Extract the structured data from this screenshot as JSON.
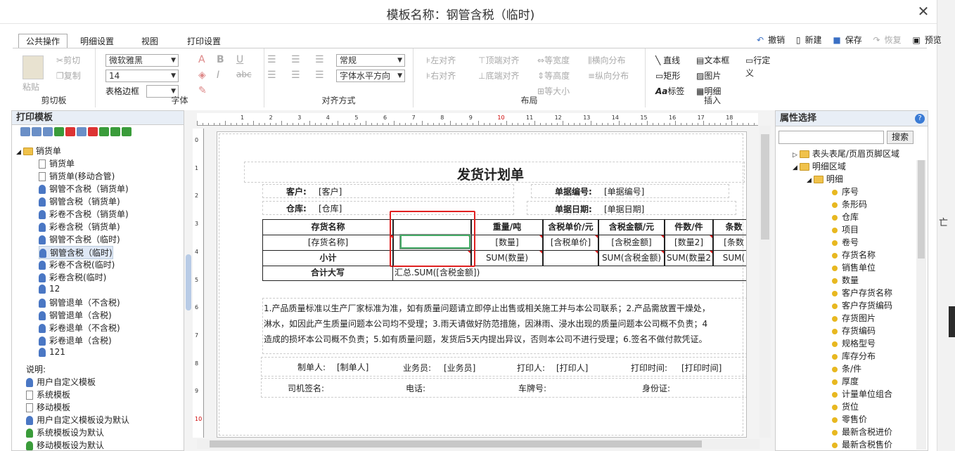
{
  "window": {
    "title": "模板名称：钢管含税（临时)",
    "close": "✕"
  },
  "ribbon": {
    "tabs": [
      "公共操作",
      "明细设置",
      "视图",
      "打印设置"
    ],
    "quick": {
      "undo": "撤销",
      "new": "新建",
      "save": "保存",
      "restore": "恢复",
      "preview": "预览"
    },
    "clipboard": {
      "paste": "粘贴",
      "cut": "剪切",
      "copy": "复制",
      "label": "剪切板"
    },
    "font": {
      "family": "微软雅黑",
      "size": "14",
      "border_label": "表格边框",
      "label": "字体"
    },
    "align": {
      "style": "常规",
      "direction": "字体水平方向",
      "label": "对齐方式"
    },
    "layout": {
      "left": "左对齐",
      "right": "右对齐",
      "top": "顶端对齐",
      "bottom": "底端对齐",
      "eqw": "等宽度",
      "eqh": "等高度",
      "eqsize": "等大小",
      "hdist": "横向分布",
      "vdist": "纵向分布",
      "label": "布局"
    },
    "insert": {
      "line": "直线",
      "rect": "矩形",
      "tag": "标签",
      "textbox": "文本框",
      "image": "图片",
      "detail": "明细",
      "rowdef": "行定义",
      "label": "插入"
    }
  },
  "left": {
    "title": "打印模板",
    "root": "销货单",
    "items": [
      "销货单",
      "销货单(移动合管)",
      "钢管不含税（销货单)",
      "钢管含税（销货单)",
      "彩卷不含税（销货单)",
      "彩卷含税（销货单)",
      "钢管不含税（临时)",
      "钢管含税（临时)",
      "彩卷不含税(临时)",
      "彩卷含税(临时)",
      "12",
      "钢管退单（不含税)",
      "钢管退单（含税)",
      "彩卷退单（不含税)",
      "彩卷退单（含税)",
      "121"
    ],
    "notes_title": "说明:",
    "notes": [
      "用户自定义模板",
      "系统模板",
      "移动模板",
      "用户自定义模板设为默认",
      "系统模板设为默认",
      "移动模板设为默认"
    ]
  },
  "ruler": {
    "h": [
      "1",
      "2",
      "3",
      "4",
      "5",
      "6",
      "7",
      "8",
      "9",
      "10",
      "11",
      "12",
      "13",
      "14",
      "15",
      "16",
      "17",
      "18"
    ],
    "v": [
      "0",
      "1",
      "2",
      "3",
      "4",
      "5",
      "6",
      "7",
      "8",
      "9",
      "10"
    ]
  },
  "doc": {
    "title": "发货计划单",
    "customer_label": "客户:",
    "customer_val": "[客户]",
    "billno_label": "单据编号:",
    "billno_val": "[单据编号]",
    "warehouse_label": "仓库:",
    "warehouse_val": "[仓库]",
    "billdate_label": "单据日期:",
    "billdate_val": "[单据日期]",
    "headers": [
      "存货名称",
      "",
      "重量/吨",
      "含税单价/元",
      "含税金额/元",
      "件数/件",
      "条数"
    ],
    "row1": [
      "[存货名称]",
      "",
      "[数量]",
      "[含税单价]",
      "[含税金额]",
      "[数量2]",
      "[条数"
    ],
    "row2": [
      "小计",
      "",
      "SUM(数量)",
      "",
      "SUM(含税金额)",
      "SUM(数量2",
      "SUM("
    ],
    "total_label": "合计大写",
    "total_val": "汇总.SUM([含税金额])",
    "notes": [
      "1.产品质量标准以生产厂家标准为准，如有质量问题请立即停止出售或相关施工并与本公司联系；2.产品需放置干燥处，",
      "淋水，如因此产生质量问题本公司均不受理；3.雨天请做好防范措施，因淋雨、浸水出现的质量问题本公司概不负责；4",
      "造成的损坏本公司概不负责；5.如有质量问题，发货后5天内提出异议，否则本公司不进行受理；6.签名不做付款凭证。"
    ],
    "maker_label": "制单人:",
    "maker_val": "[制单人]",
    "sales_label": "业务员:",
    "sales_val": "[业务员]",
    "printer_label": "打印人:",
    "printer_val": "[打印人]",
    "ptime_label": "打印时间:",
    "ptime_val": "[打印时间]",
    "driver_label": "司机签名:",
    "phone_label": "电话:",
    "plate_label": "车牌号:",
    "idcard_label": "身份证:"
  },
  "right": {
    "title": "属性选择",
    "search_btn": "搜索",
    "nodes": [
      "表头表尾/页眉页脚区域",
      "明细区域",
      "明细"
    ],
    "fields": [
      "序号",
      "条形码",
      "仓库",
      "项目",
      "卷号",
      "存货名称",
      "销售单位",
      "数量",
      "客户存货名称",
      "客户存货编码",
      "存货图片",
      "存货编码",
      "规格型号",
      "库存分布",
      "条/件",
      "厚度",
      "计量单位组合",
      "货位",
      "零售价",
      "最新含税进价",
      "最新含税售价"
    ]
  },
  "colors": {
    "highlight": "#e02020",
    "panel_header": "#e8eef6",
    "accent": "#3a7bd5"
  }
}
